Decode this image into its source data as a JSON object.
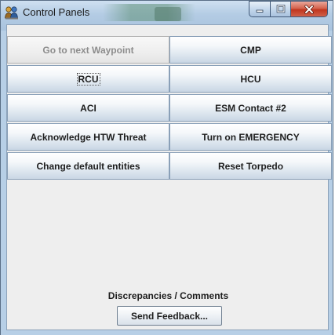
{
  "window": {
    "title": "Control Panels",
    "app_icon": "people-icon",
    "controls": {
      "minimize_icon": "minimize-icon",
      "maximize_icon": "maximize-icon",
      "close_icon": "close-icon"
    }
  },
  "buttons": [
    {
      "label": "Go to next Waypoint",
      "enabled": false
    },
    {
      "label": "CMP",
      "enabled": true
    },
    {
      "label": "RCU",
      "enabled": true,
      "focused": true
    },
    {
      "label": "HCU",
      "enabled": true
    },
    {
      "label": "ACI",
      "enabled": true
    },
    {
      "label": "ESM Contact #2",
      "enabled": true
    },
    {
      "label": "Acknowledge HTW Threat",
      "enabled": true
    },
    {
      "label": "Turn on EMERGENCY",
      "enabled": true
    },
    {
      "label": "Change default entities",
      "enabled": true
    },
    {
      "label": "Reset Torpedo",
      "enabled": true
    }
  ],
  "feedback": {
    "section_label": "Discrepancies / Comments",
    "button_label": "Send Feedback..."
  },
  "colors": {
    "frame": "#b7cfe6",
    "content_bg": "#eeeeee",
    "close_red": "#c0361f"
  }
}
